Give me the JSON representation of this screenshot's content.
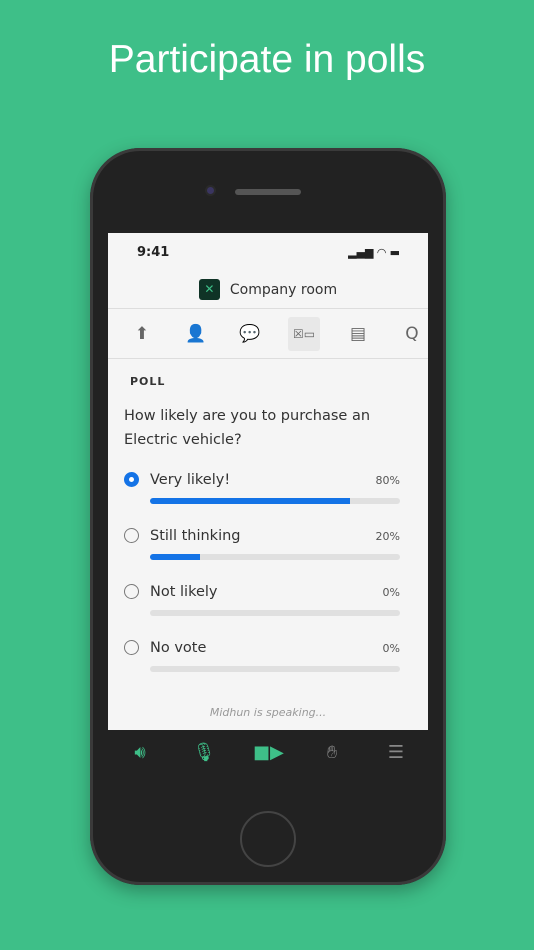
{
  "headline": "Participate in polls",
  "status": {
    "time": "9:41"
  },
  "room": {
    "title": "Company room"
  },
  "tabs": [
    {
      "icon": "share-upload-icon"
    },
    {
      "icon": "camera-pod-icon"
    },
    {
      "icon": "chat-icon"
    },
    {
      "icon": "poll-icon",
      "active": true
    },
    {
      "icon": "notes-icon"
    },
    {
      "icon": "qa-icon"
    }
  ],
  "poll": {
    "label": "POLL",
    "question": "How likely are you to purchase an Electric vehicle?",
    "options": [
      {
        "name": "Very likely!",
        "percent_label": "80%",
        "percent": 80,
        "selected": true
      },
      {
        "name": "Still thinking",
        "percent_label": "20%",
        "percent": 20,
        "selected": false
      },
      {
        "name": "Not likely",
        "percent_label": "0%",
        "percent": 0,
        "selected": false
      },
      {
        "name": "No vote",
        "percent_label": "0%",
        "percent": 0,
        "selected": false
      }
    ]
  },
  "speaking": "Midhun is speaking...",
  "colors": {
    "accent": "#1473e6",
    "brand": "#3ebf88"
  }
}
